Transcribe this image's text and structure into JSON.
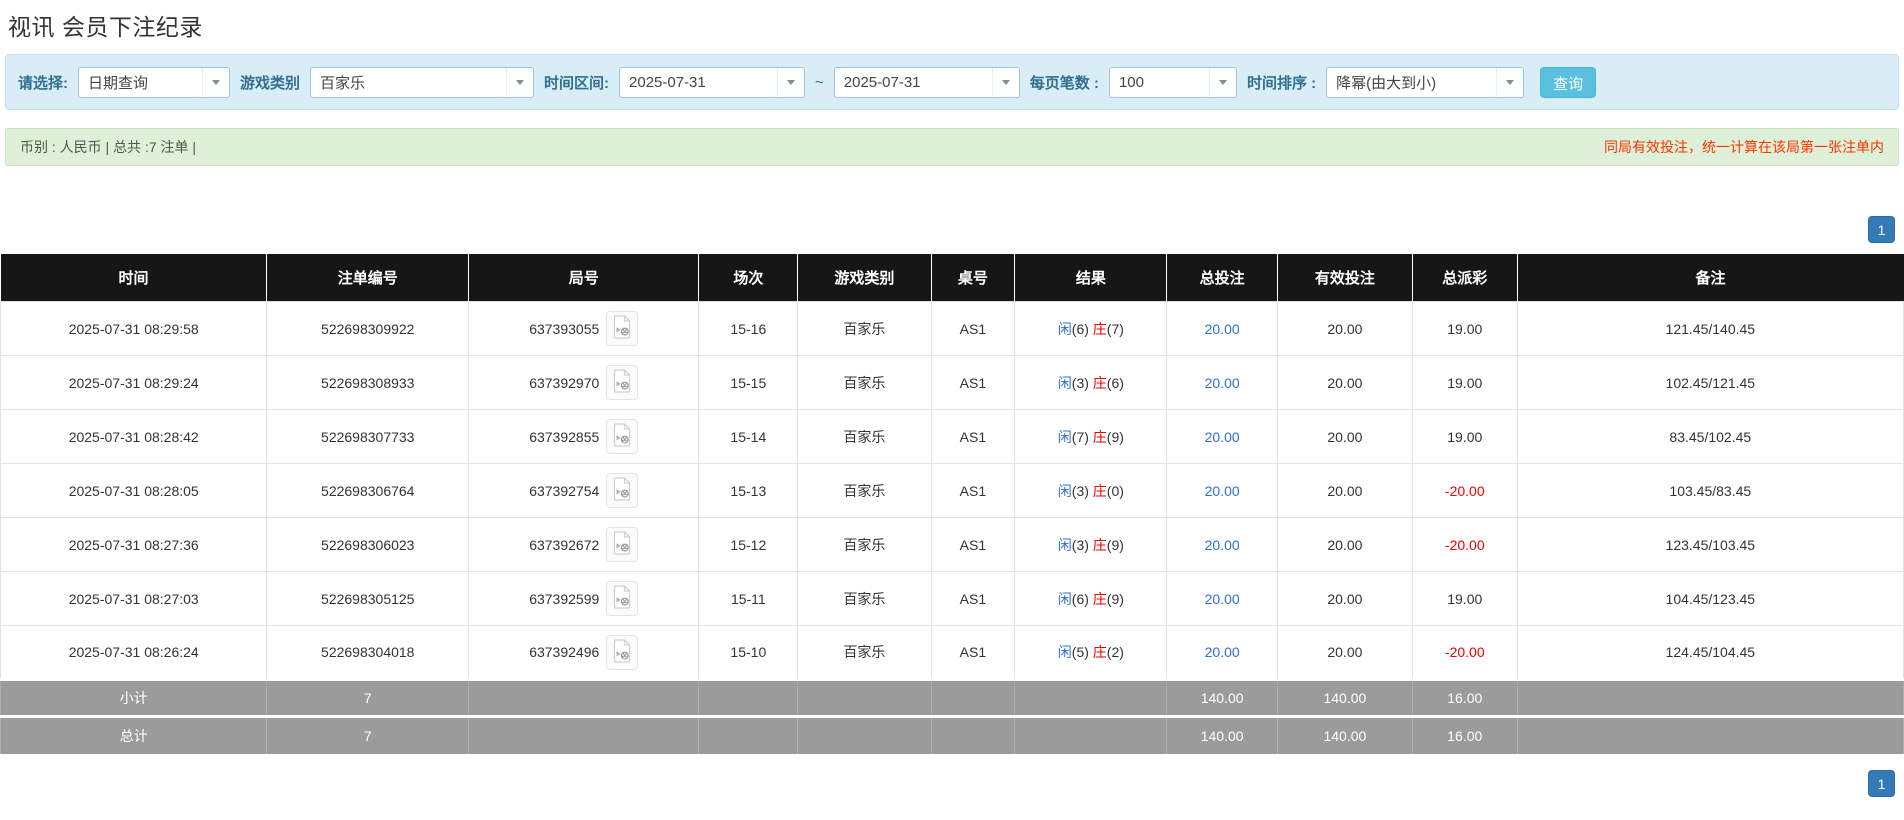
{
  "page": {
    "title": "视讯 会员下注纪录"
  },
  "filters": {
    "select_label": "请选择:",
    "select_value": "日期查询",
    "game_type_label": "游戏类别",
    "game_type_value": "百家乐",
    "date_range_label": "时间区间:",
    "date_from": "2025-07-31",
    "date_separator": "~",
    "date_to": "2025-07-31",
    "page_size_label": "每页笔数 :",
    "page_size_value": "100",
    "sort_label": "时间排序 :",
    "sort_value": "降幂(由大到小)",
    "search_button": "查询"
  },
  "summary": {
    "left_text": "币别 : 人民币 | 总共 :7 注单 |",
    "right_notice": "同局有效投注，统一计算在该局第一张注单内"
  },
  "pagination": {
    "page": "1"
  },
  "table": {
    "headers": [
      "时间",
      "注单编号",
      "局号",
      "场次",
      "游戏类别",
      "桌号",
      "结果",
      "总投注",
      "有效投注",
      "总派彩",
      "备注"
    ],
    "col_widths_pct": [
      14.0,
      10.6,
      12.1,
      5.2,
      7.0,
      4.4,
      8.0,
      5.8,
      7.1,
      5.5,
      20.3
    ],
    "rows": [
      {
        "time": "2025-07-31 08:29:58",
        "bet_id": "522698309922",
        "round_id": "637393055",
        "session": "15-16",
        "game": "百家乐",
        "table_no": "AS1",
        "result": {
          "player_label": "闲",
          "player_num": "(6)",
          "banker_label": "庄",
          "banker_num": "(7)"
        },
        "total_bet": "20.00",
        "valid_bet": "20.00",
        "payout": "19.00",
        "remark": "121.45/140.45"
      },
      {
        "time": "2025-07-31 08:29:24",
        "bet_id": "522698308933",
        "round_id": "637392970",
        "session": "15-15",
        "game": "百家乐",
        "table_no": "AS1",
        "result": {
          "player_label": "闲",
          "player_num": "(3)",
          "banker_label": "庄",
          "banker_num": "(6)"
        },
        "total_bet": "20.00",
        "valid_bet": "20.00",
        "payout": "19.00",
        "remark": "102.45/121.45"
      },
      {
        "time": "2025-07-31 08:28:42",
        "bet_id": "522698307733",
        "round_id": "637392855",
        "session": "15-14",
        "game": "百家乐",
        "table_no": "AS1",
        "result": {
          "player_label": "闲",
          "player_num": "(7)",
          "banker_label": "庄",
          "banker_num": "(9)"
        },
        "total_bet": "20.00",
        "valid_bet": "20.00",
        "payout": "19.00",
        "remark": "83.45/102.45"
      },
      {
        "time": "2025-07-31 08:28:05",
        "bet_id": "522698306764",
        "round_id": "637392754",
        "session": "15-13",
        "game": "百家乐",
        "table_no": "AS1",
        "result": {
          "player_label": "闲",
          "player_num": "(3)",
          "banker_label": "庄",
          "banker_num": "(0)"
        },
        "total_bet": "20.00",
        "valid_bet": "20.00",
        "payout": "-20.00",
        "remark": "103.45/83.45"
      },
      {
        "time": "2025-07-31 08:27:36",
        "bet_id": "522698306023",
        "round_id": "637392672",
        "session": "15-12",
        "game": "百家乐",
        "table_no": "AS1",
        "result": {
          "player_label": "闲",
          "player_num": "(3)",
          "banker_label": "庄",
          "banker_num": "(9)"
        },
        "total_bet": "20.00",
        "valid_bet": "20.00",
        "payout": "-20.00",
        "remark": "123.45/103.45"
      },
      {
        "time": "2025-07-31 08:27:03",
        "bet_id": "522698305125",
        "round_id": "637392599",
        "session": "15-11",
        "game": "百家乐",
        "table_no": "AS1",
        "result": {
          "player_label": "闲",
          "player_num": "(6)",
          "banker_label": "庄",
          "banker_num": "(9)"
        },
        "total_bet": "20.00",
        "valid_bet": "20.00",
        "payout": "19.00",
        "remark": "104.45/123.45"
      },
      {
        "time": "2025-07-31 08:26:24",
        "bet_id": "522698304018",
        "round_id": "637392496",
        "session": "15-10",
        "game": "百家乐",
        "table_no": "AS1",
        "result": {
          "player_label": "闲",
          "player_num": "(5)",
          "banker_label": "庄",
          "banker_num": "(2)"
        },
        "total_bet": "20.00",
        "valid_bet": "20.00",
        "payout": "-20.00",
        "remark": "124.45/104.45"
      }
    ],
    "subtotal": {
      "label": "小计",
      "count": "7",
      "total_bet": "140.00",
      "valid_bet": "140.00",
      "payout": "16.00"
    },
    "total": {
      "label": "总计",
      "count": "7",
      "total_bet": "140.00",
      "valid_bet": "140.00",
      "payout": "16.00"
    }
  },
  "colors": {
    "accent_blue": "#337ab7",
    "link_blue": "#2e6fd8",
    "negative_red": "#ee0000",
    "notice_red": "#ff3300",
    "filter_bg": "#d9edf7",
    "filter_border": "#c2dff0",
    "filter_label": "#31708f",
    "combo_border": "#9fc6de",
    "success_bg": "#dff0d8",
    "success_border": "#d0e6c2",
    "success_text": "#4e5a4e",
    "header_bg": "#161616",
    "footer_bg": "#9b9b9b",
    "footer_divider": "#aeaeae",
    "row_border": "#e2e2e2",
    "search_btn_bg": "#5bc0de",
    "search_btn_border": "#46b8da",
    "pagination_bg": "#337ab7"
  }
}
